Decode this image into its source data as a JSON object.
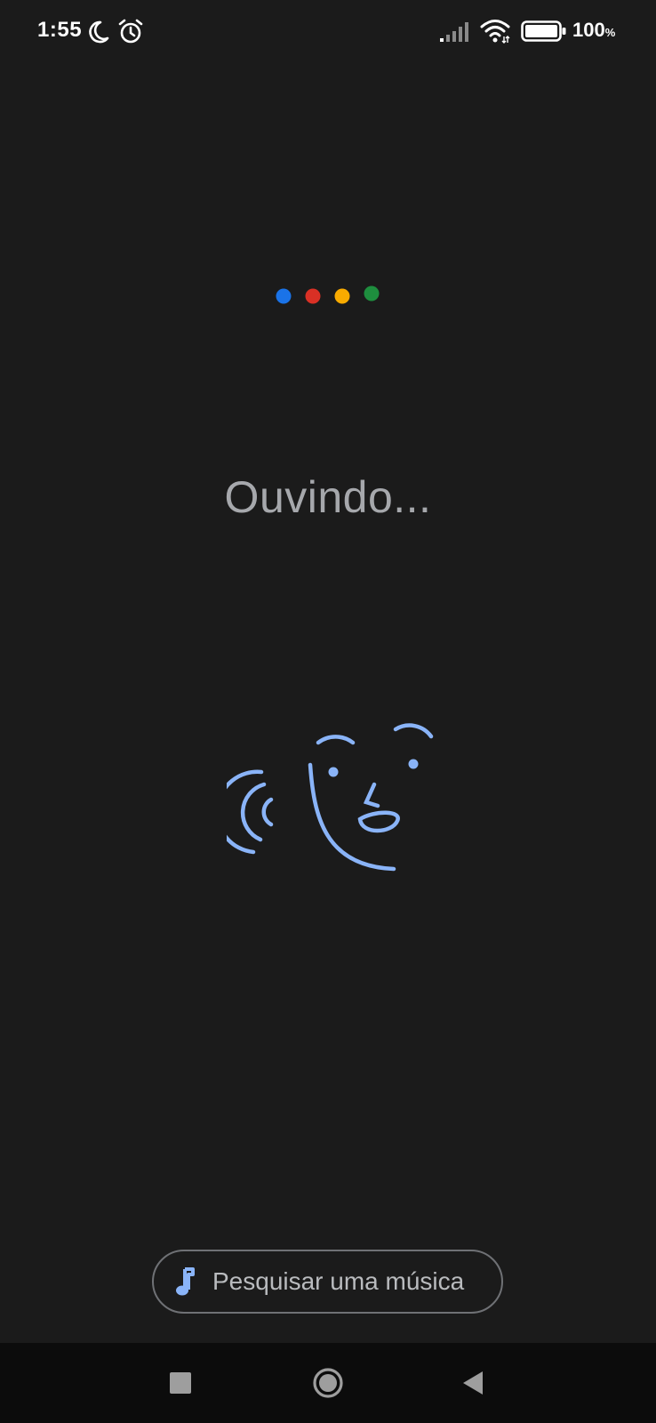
{
  "status_bar": {
    "time": "1:55",
    "battery_level": "100",
    "battery_unit": "%",
    "icons": [
      "moon-icon",
      "alarm-icon",
      "signal-icon",
      "wifi-icon",
      "battery-icon"
    ]
  },
  "assistant": {
    "dot_colors": [
      "#1a73e8",
      "#d93025",
      "#f9ab00",
      "#1e8e3e"
    ],
    "listening_text": "Ouvindo...",
    "illustration_color": "#8ab4f8"
  },
  "song_search": {
    "label": "Pesquisar uma música",
    "icon": "music-note-icon"
  },
  "nav_bar": {
    "buttons": [
      "recents-button",
      "home-button",
      "back-button"
    ]
  }
}
